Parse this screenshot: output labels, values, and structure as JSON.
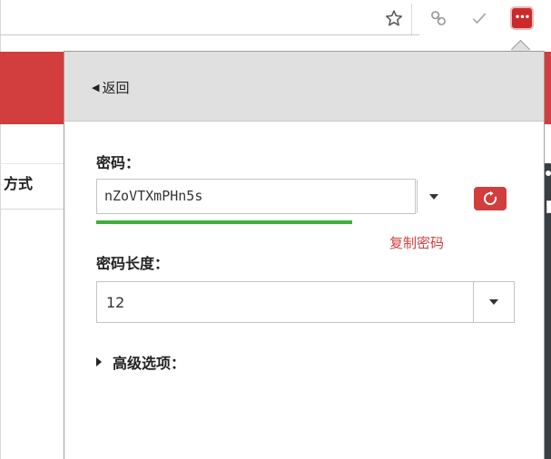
{
  "browser": {
    "icons": {
      "bookmark": "star-icon",
      "link": "link-icon",
      "check": "check-icon",
      "extension": "lastpass-icon"
    },
    "extension_dots": "•••"
  },
  "background_page": {
    "side_label": "方式"
  },
  "popup": {
    "back_label": "返回",
    "password_label": "密码：",
    "password_value": "nZoVTXmPHn5s",
    "password_strength": 0.78,
    "copy_label": "复制密码",
    "length_label": "密码长度：",
    "length_value": "12",
    "advanced_label": "高级选项："
  },
  "colors": {
    "accent_red": "#d23d3d",
    "strength_green": "#3fae3f",
    "header_gray": "#e0e0e0"
  }
}
